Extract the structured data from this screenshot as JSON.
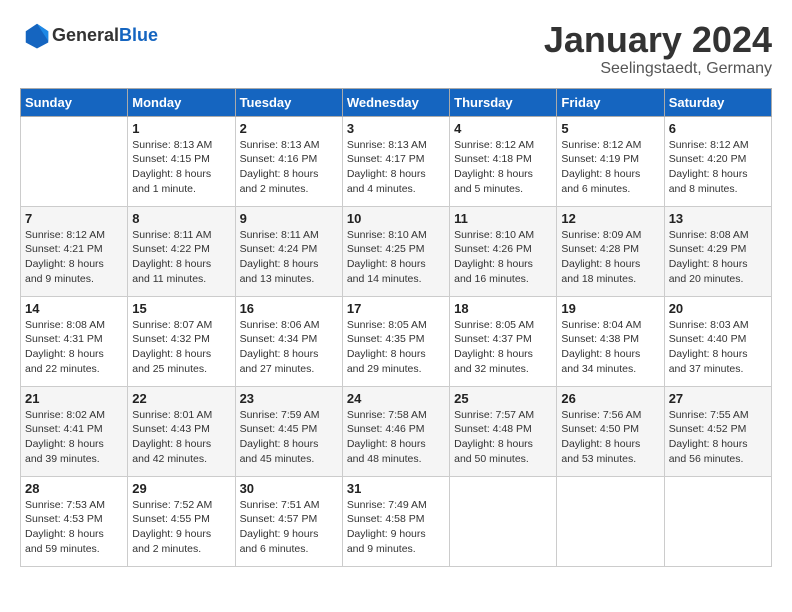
{
  "header": {
    "logo_general": "General",
    "logo_blue": "Blue",
    "month": "January 2024",
    "location": "Seelingstaedt, Germany"
  },
  "days_of_week": [
    "Sunday",
    "Monday",
    "Tuesday",
    "Wednesday",
    "Thursday",
    "Friday",
    "Saturday"
  ],
  "weeks": [
    [
      {
        "day": "",
        "sunrise": "",
        "sunset": "",
        "daylight": ""
      },
      {
        "day": "1",
        "sunrise": "Sunrise: 8:13 AM",
        "sunset": "Sunset: 4:15 PM",
        "daylight": "Daylight: 8 hours and 1 minute."
      },
      {
        "day": "2",
        "sunrise": "Sunrise: 8:13 AM",
        "sunset": "Sunset: 4:16 PM",
        "daylight": "Daylight: 8 hours and 2 minutes."
      },
      {
        "day": "3",
        "sunrise": "Sunrise: 8:13 AM",
        "sunset": "Sunset: 4:17 PM",
        "daylight": "Daylight: 8 hours and 4 minutes."
      },
      {
        "day": "4",
        "sunrise": "Sunrise: 8:12 AM",
        "sunset": "Sunset: 4:18 PM",
        "daylight": "Daylight: 8 hours and 5 minutes."
      },
      {
        "day": "5",
        "sunrise": "Sunrise: 8:12 AM",
        "sunset": "Sunset: 4:19 PM",
        "daylight": "Daylight: 8 hours and 6 minutes."
      },
      {
        "day": "6",
        "sunrise": "Sunrise: 8:12 AM",
        "sunset": "Sunset: 4:20 PM",
        "daylight": "Daylight: 8 hours and 8 minutes."
      }
    ],
    [
      {
        "day": "7",
        "sunrise": "Sunrise: 8:12 AM",
        "sunset": "Sunset: 4:21 PM",
        "daylight": "Daylight: 8 hours and 9 minutes."
      },
      {
        "day": "8",
        "sunrise": "Sunrise: 8:11 AM",
        "sunset": "Sunset: 4:22 PM",
        "daylight": "Daylight: 8 hours and 11 minutes."
      },
      {
        "day": "9",
        "sunrise": "Sunrise: 8:11 AM",
        "sunset": "Sunset: 4:24 PM",
        "daylight": "Daylight: 8 hours and 13 minutes."
      },
      {
        "day": "10",
        "sunrise": "Sunrise: 8:10 AM",
        "sunset": "Sunset: 4:25 PM",
        "daylight": "Daylight: 8 hours and 14 minutes."
      },
      {
        "day": "11",
        "sunrise": "Sunrise: 8:10 AM",
        "sunset": "Sunset: 4:26 PM",
        "daylight": "Daylight: 8 hours and 16 minutes."
      },
      {
        "day": "12",
        "sunrise": "Sunrise: 8:09 AM",
        "sunset": "Sunset: 4:28 PM",
        "daylight": "Daylight: 8 hours and 18 minutes."
      },
      {
        "day": "13",
        "sunrise": "Sunrise: 8:08 AM",
        "sunset": "Sunset: 4:29 PM",
        "daylight": "Daylight: 8 hours and 20 minutes."
      }
    ],
    [
      {
        "day": "14",
        "sunrise": "Sunrise: 8:08 AM",
        "sunset": "Sunset: 4:31 PM",
        "daylight": "Daylight: 8 hours and 22 minutes."
      },
      {
        "day": "15",
        "sunrise": "Sunrise: 8:07 AM",
        "sunset": "Sunset: 4:32 PM",
        "daylight": "Daylight: 8 hours and 25 minutes."
      },
      {
        "day": "16",
        "sunrise": "Sunrise: 8:06 AM",
        "sunset": "Sunset: 4:34 PM",
        "daylight": "Daylight: 8 hours and 27 minutes."
      },
      {
        "day": "17",
        "sunrise": "Sunrise: 8:05 AM",
        "sunset": "Sunset: 4:35 PM",
        "daylight": "Daylight: 8 hours and 29 minutes."
      },
      {
        "day": "18",
        "sunrise": "Sunrise: 8:05 AM",
        "sunset": "Sunset: 4:37 PM",
        "daylight": "Daylight: 8 hours and 32 minutes."
      },
      {
        "day": "19",
        "sunrise": "Sunrise: 8:04 AM",
        "sunset": "Sunset: 4:38 PM",
        "daylight": "Daylight: 8 hours and 34 minutes."
      },
      {
        "day": "20",
        "sunrise": "Sunrise: 8:03 AM",
        "sunset": "Sunset: 4:40 PM",
        "daylight": "Daylight: 8 hours and 37 minutes."
      }
    ],
    [
      {
        "day": "21",
        "sunrise": "Sunrise: 8:02 AM",
        "sunset": "Sunset: 4:41 PM",
        "daylight": "Daylight: 8 hours and 39 minutes."
      },
      {
        "day": "22",
        "sunrise": "Sunrise: 8:01 AM",
        "sunset": "Sunset: 4:43 PM",
        "daylight": "Daylight: 8 hours and 42 minutes."
      },
      {
        "day": "23",
        "sunrise": "Sunrise: 7:59 AM",
        "sunset": "Sunset: 4:45 PM",
        "daylight": "Daylight: 8 hours and 45 minutes."
      },
      {
        "day": "24",
        "sunrise": "Sunrise: 7:58 AM",
        "sunset": "Sunset: 4:46 PM",
        "daylight": "Daylight: 8 hours and 48 minutes."
      },
      {
        "day": "25",
        "sunrise": "Sunrise: 7:57 AM",
        "sunset": "Sunset: 4:48 PM",
        "daylight": "Daylight: 8 hours and 50 minutes."
      },
      {
        "day": "26",
        "sunrise": "Sunrise: 7:56 AM",
        "sunset": "Sunset: 4:50 PM",
        "daylight": "Daylight: 8 hours and 53 minutes."
      },
      {
        "day": "27",
        "sunrise": "Sunrise: 7:55 AM",
        "sunset": "Sunset: 4:52 PM",
        "daylight": "Daylight: 8 hours and 56 minutes."
      }
    ],
    [
      {
        "day": "28",
        "sunrise": "Sunrise: 7:53 AM",
        "sunset": "Sunset: 4:53 PM",
        "daylight": "Daylight: 8 hours and 59 minutes."
      },
      {
        "day": "29",
        "sunrise": "Sunrise: 7:52 AM",
        "sunset": "Sunset: 4:55 PM",
        "daylight": "Daylight: 9 hours and 2 minutes."
      },
      {
        "day": "30",
        "sunrise": "Sunrise: 7:51 AM",
        "sunset": "Sunset: 4:57 PM",
        "daylight": "Daylight: 9 hours and 6 minutes."
      },
      {
        "day": "31",
        "sunrise": "Sunrise: 7:49 AM",
        "sunset": "Sunset: 4:58 PM",
        "daylight": "Daylight: 9 hours and 9 minutes."
      },
      {
        "day": "",
        "sunrise": "",
        "sunset": "",
        "daylight": ""
      },
      {
        "day": "",
        "sunrise": "",
        "sunset": "",
        "daylight": ""
      },
      {
        "day": "",
        "sunrise": "",
        "sunset": "",
        "daylight": ""
      }
    ]
  ]
}
